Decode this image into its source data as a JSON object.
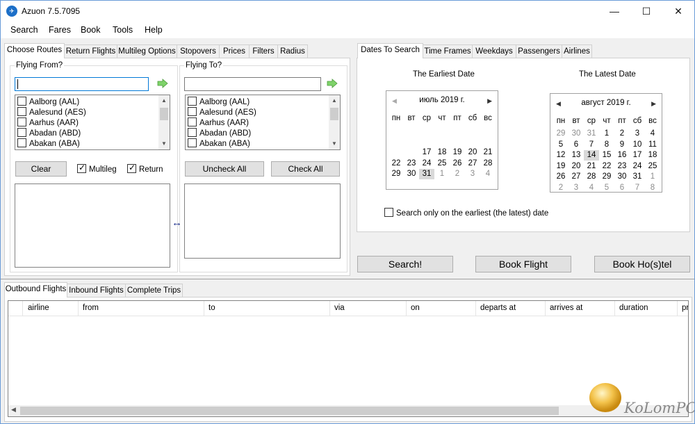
{
  "window": {
    "title": "Azuon 7.5.7095",
    "icon": "app-icon",
    "controls": {
      "minimize": "—",
      "maximize": "☐",
      "close": "✕"
    }
  },
  "menu": [
    "Search",
    "Fares",
    "Book",
    "Tools",
    "Help"
  ],
  "left_tabs": [
    "Choose Routes",
    "Return Flights",
    "Multileg Options",
    "Stopovers",
    "Prices",
    "Filters",
    "Radius"
  ],
  "routes": {
    "from_label": "Flying From?",
    "to_label": "Flying To?",
    "from_value": "",
    "to_value": "",
    "airports": [
      "Aalborg (AAL)",
      "Aalesund (AES)",
      "Aarhus (AAR)",
      "Abadan (ABD)",
      "Abakan (ABA)"
    ],
    "clear_button": "Clear",
    "multileg_label": "Multileg",
    "multileg_checked": true,
    "return_label": "Return",
    "return_checked": true,
    "uncheck_all_button": "Uncheck All",
    "check_all_button": "Check All",
    "swap_icon": "↔"
  },
  "right_tabs": [
    "Dates To Search",
    "Time Frames",
    "Weekdays",
    "Passengers",
    "Airlines"
  ],
  "dates": {
    "earliest_label": "The Earliest Date",
    "latest_label": "The Latest Date",
    "weekdays": [
      "пн",
      "вт",
      "ср",
      "чт",
      "пт",
      "сб",
      "вс"
    ],
    "earliest": {
      "month": "июль 2019 г.",
      "rows": [
        [
          "",
          "",
          "",
          "",
          "",
          "",
          ""
        ],
        [
          "",
          "",
          "",
          "",
          "",
          "",
          ""
        ],
        [
          "",
          "",
          "17",
          "18",
          "19",
          "20",
          "21"
        ],
        [
          "22",
          "23",
          "24",
          "25",
          "26",
          "27",
          "28"
        ],
        [
          "29",
          "30",
          "31",
          "1",
          "2",
          "3",
          "4"
        ]
      ],
      "selected": "31"
    },
    "latest": {
      "month": "август 2019 г.",
      "rows": [
        [
          "29",
          "30",
          "31",
          "1",
          "2",
          "3",
          "4"
        ],
        [
          "5",
          "6",
          "7",
          "8",
          "9",
          "10",
          "11"
        ],
        [
          "12",
          "13",
          "14",
          "15",
          "16",
          "17",
          "18"
        ],
        [
          "19",
          "20",
          "21",
          "22",
          "23",
          "24",
          "25"
        ],
        [
          "26",
          "27",
          "28",
          "29",
          "30",
          "31",
          "1"
        ],
        [
          "2",
          "3",
          "4",
          "5",
          "6",
          "7",
          "8"
        ]
      ],
      "selected": "14"
    },
    "earliest_only_label": "Search only on the earliest (the latest) date",
    "earliest_only_checked": false
  },
  "actions": {
    "search": "Search!",
    "book_flight": "Book Flight",
    "book_hostel": "Book Ho(s)tel"
  },
  "result_tabs": [
    "Outbound Flights",
    "Inbound Flights",
    "Complete Trips"
  ],
  "columns": [
    "airline",
    "from",
    "to",
    "via",
    "on",
    "departs at",
    "arrives at",
    "duration",
    "pr"
  ],
  "watermark": "KoLomPC"
}
